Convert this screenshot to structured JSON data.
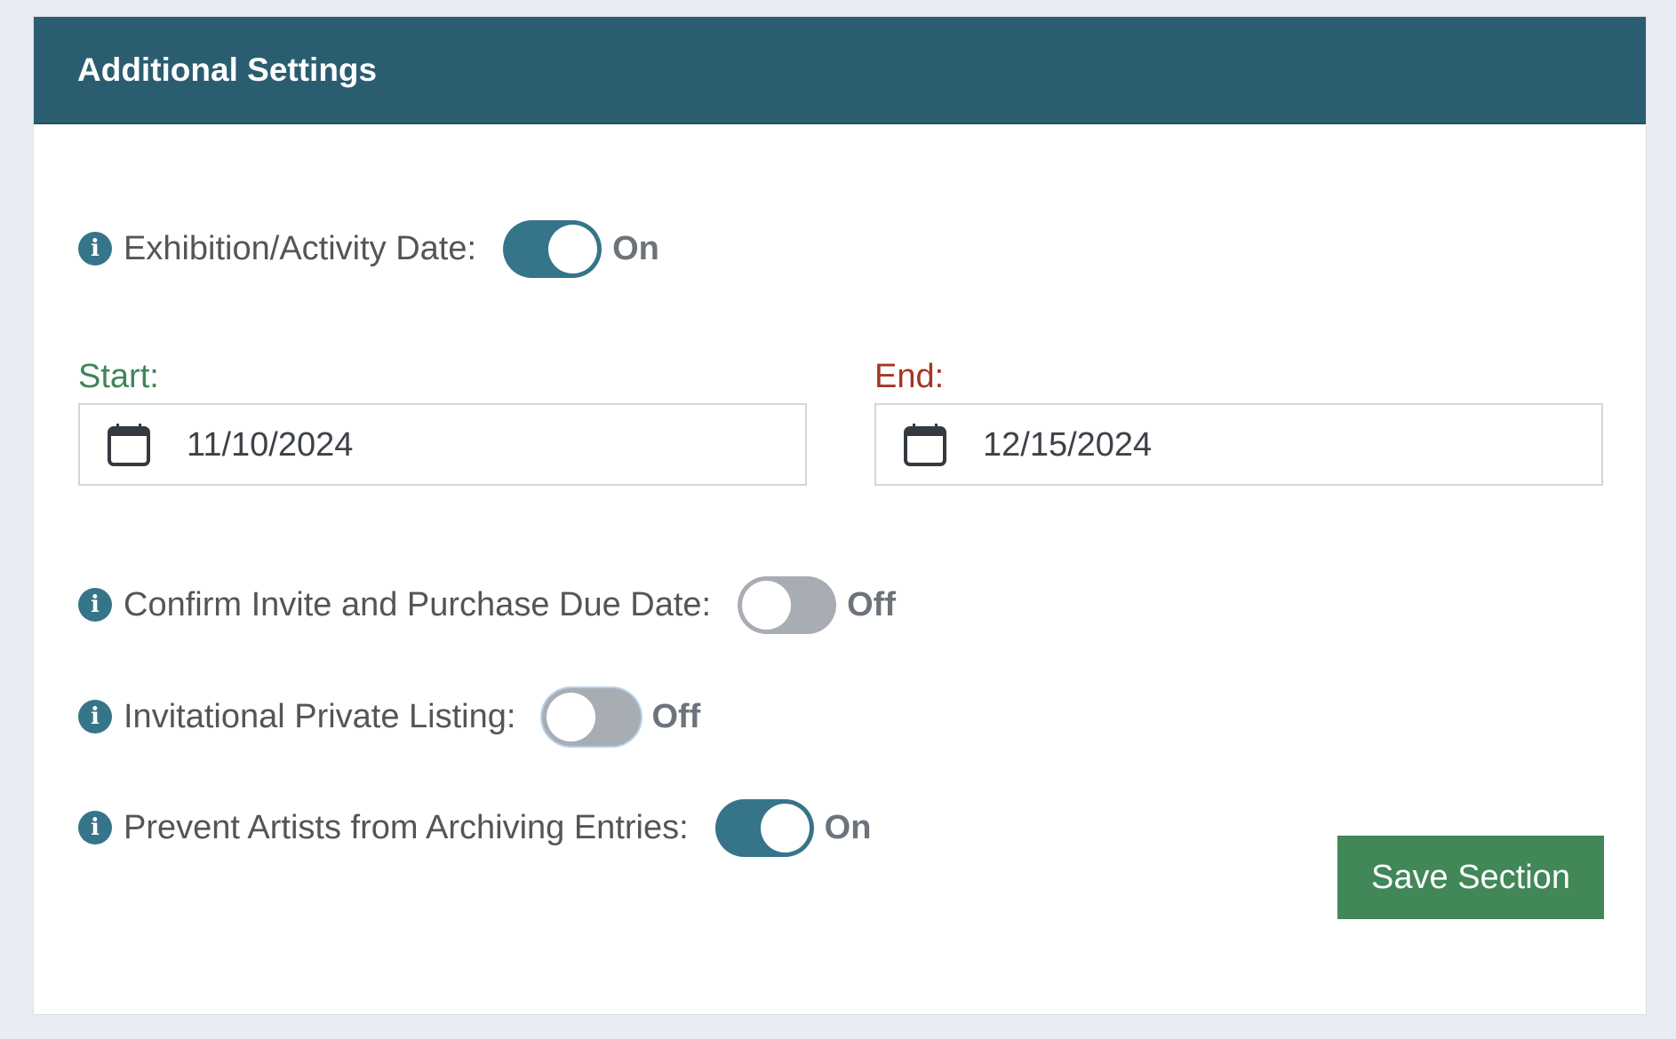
{
  "panel": {
    "title": "Additional Settings"
  },
  "exhibition_date": {
    "label": "Exhibition/Activity Date:",
    "icon": "info-icon",
    "toggle_state": "On",
    "enabled": true,
    "start": {
      "label": "Start:",
      "icon": "calendar-icon",
      "value": "11/10/2024",
      "label_color": "#3f8657"
    },
    "end": {
      "label": "End:",
      "icon": "calendar-icon",
      "value": "12/15/2024",
      "label_color": "#a53524"
    }
  },
  "settings": [
    {
      "label": "Confirm Invite and Purchase Due Date:",
      "icon": "info-icon",
      "state": "Off",
      "enabled": false
    },
    {
      "label": "Invitational Private Listing:",
      "icon": "info-icon",
      "state": "Off",
      "enabled": false,
      "focused": true
    },
    {
      "label": "Prevent Artists from Archiving Entries:",
      "icon": "info-icon",
      "state": "On",
      "enabled": true
    }
  ],
  "actions": {
    "save_label": "Save Section"
  },
  "colors": {
    "header": "#2b5d70",
    "toggle_on": "#36748a",
    "toggle_off": "#a8adb3",
    "save_button": "#418758",
    "page_background": "#e9ecf3"
  }
}
